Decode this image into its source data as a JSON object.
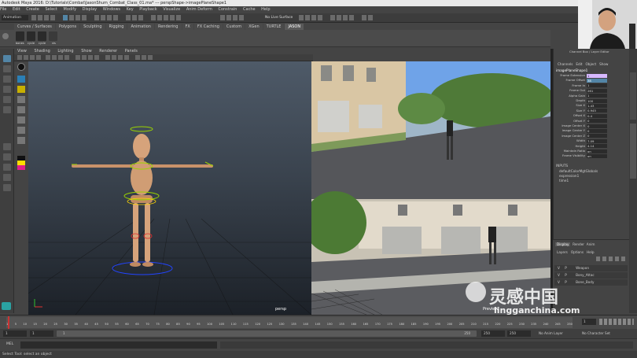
{
  "window": {
    "title": "Autodesk Maya 2016: D:\\Tutorials\\Combat\\JasonShum_Combat_Class_01.ma*  ---  perspShape->imagePlaneShape1"
  },
  "menubar": {
    "items": [
      "File",
      "Edit",
      "Create",
      "Select",
      "Modify",
      "Display",
      "Windows",
      "Key",
      "Playback",
      "Visualize",
      "Anim Deform",
      "Constrain",
      "Cache",
      "Help"
    ]
  },
  "statusline": {
    "workspace": "Animation",
    "live_surface": "No Live Surface"
  },
  "shelf": {
    "tabs": [
      "Curves / Surfaces",
      "Polygons",
      "Sculpting",
      "Rigging",
      "Animation",
      "Rendering",
      "FX",
      "FX Caching",
      "Custom",
      "XGen",
      "TURTLE",
      "JASON"
    ],
    "active_tab": "JASON",
    "icon_labels": [
      "bones",
      "cycle",
      "cycle",
      "vis"
    ]
  },
  "panel": {
    "menu": [
      "View",
      "Shading",
      "Lighting",
      "Show",
      "Renderer",
      "Panels"
    ],
    "label": "persp",
    "image_label": "Preview"
  },
  "attr_editor": {
    "header": "Channel Box / Layer Editor",
    "menu": [
      "Channels",
      "Edit",
      "Object",
      "Show"
    ],
    "node": "imagePlaneShape1",
    "rows": [
      {
        "k": "Frame Extension",
        "v": "1"
      },
      {
        "k": "Frame Offset",
        "v": "38"
      },
      {
        "k": "Frame In",
        "v": "1"
      },
      {
        "k": "Frame Out",
        "v": "261"
      },
      {
        "k": "Alpha Gain",
        "v": "1"
      },
      {
        "k": "Depth",
        "v": "100"
      },
      {
        "k": "Size X",
        "v": "1.43"
      },
      {
        "k": "Size Y",
        "v": "0.945"
      },
      {
        "k": "Offset X",
        "v": "0.4"
      },
      {
        "k": "Offset Y",
        "v": "0"
      },
      {
        "k": "Image Center X",
        "v": "0"
      },
      {
        "k": "Image Center Y",
        "v": "0"
      },
      {
        "k": "Image Center Z",
        "v": "0"
      },
      {
        "k": "Width",
        "v": "7.09"
      },
      {
        "k": "Height",
        "v": "4.14"
      },
      {
        "k": "Maintain Ratio",
        "v": "on"
      },
      {
        "k": "Frame Visibility",
        "v": "on"
      }
    ],
    "inputs_title": "INPUTS",
    "inputs": [
      "defaultColorMgtGlobals",
      "expression1",
      "time1"
    ]
  },
  "layer_editor": {
    "tabs": [
      "Display",
      "Render",
      "Anim"
    ],
    "menu": [
      "Layers",
      "Options",
      "Help"
    ],
    "layers": [
      {
        "v": "V",
        "p": "P",
        "name": "Weapon"
      },
      {
        "v": "V",
        "p": "P",
        "name": "Bony_Attac"
      },
      {
        "v": "V",
        "p": "P",
        "name": "Bone_Body"
      }
    ]
  },
  "timeline": {
    "ticks": [
      "1",
      "5",
      "10",
      "15",
      "20",
      "25",
      "30",
      "35",
      "40",
      "45",
      "50",
      "55",
      "60",
      "65",
      "70",
      "75",
      "80",
      "85",
      "90",
      "95",
      "100",
      "105",
      "110",
      "115",
      "120",
      "125",
      "130",
      "135",
      "140",
      "145",
      "150",
      "155",
      "160",
      "165",
      "170",
      "175",
      "180",
      "185",
      "190",
      "195",
      "200",
      "205",
      "210",
      "215",
      "220",
      "225",
      "230",
      "235",
      "240",
      "245",
      "250"
    ],
    "current_frame": "1",
    "start": "1",
    "start2": "1",
    "range_start": "1",
    "range_end": "250",
    "end1": "250",
    "end2": "250",
    "anim_layer": "No Anim Layer",
    "char_set": "No Character Set",
    "cmd_label": "MEL"
  },
  "helpline": "Select Tool: select an object",
  "watermark": {
    "cn": "灵感中国",
    "url": "lingganchina.com"
  },
  "colors": {
    "accent": "#5285a6",
    "viewport_top": "#4e5a68",
    "highlight": "#d7b8ff"
  }
}
